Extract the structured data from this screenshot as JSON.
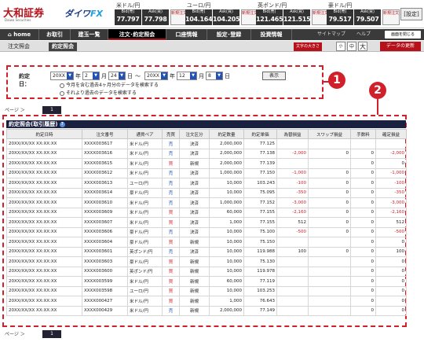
{
  "header": {
    "logo": "大和証券",
    "logo_sub": "Daiwa Securities",
    "fx_logo_a": "ダイワ",
    "fx_logo_b": "FX",
    "settings_label": "[設定]",
    "rates": [
      {
        "pair": "米ドル/円",
        "bid_label": "Bid(売)",
        "ask_label": "Ask(買)",
        "bid": "77.797",
        "ask": "77.798",
        "new_label": "新規注文"
      },
      {
        "pair": "ユーロ/円",
        "bid_label": "Bid(売)",
        "ask_label": "Ask(買)",
        "bid": "104.164",
        "ask": "104.205",
        "new_label": "新規注文"
      },
      {
        "pair": "英ポンド/円",
        "bid_label": "Bid(売)",
        "ask_label": "Ask(買)",
        "bid": "121.465",
        "ask": "121.515",
        "new_label": "新規注文"
      },
      {
        "pair": "豪ドル/円",
        "bid_label": "Bid(売)",
        "ask_label": "Ask(買)",
        "bid": "79.517",
        "ask": "79.507",
        "new_label": "新規注文"
      }
    ]
  },
  "nav": {
    "items": [
      "⌂ home",
      "お取引",
      "建玉一覧",
      "注文･約定照会",
      "口座情報",
      "設定･登録",
      "投資情報"
    ],
    "sitemap": "サイトマップ",
    "help": "ヘルプ",
    "close_label": "画面を閉じる"
  },
  "subnav": {
    "items": [
      "注文照会",
      "約定照会"
    ],
    "font_size_label": "文字の大きさ",
    "font_sizes": [
      "小",
      "中",
      "大"
    ],
    "update_label": "データの更新"
  },
  "search": {
    "label": "約定日：",
    "from_year": "20XX",
    "from_month": "2",
    "from_day": "24",
    "to_year": "20XX",
    "to_month": "12",
    "to_day": "8",
    "year_unit": "年",
    "month_unit": "月",
    "day_unit": "日",
    "range_sep": "～",
    "show_button": "表示",
    "radio1": "今月を含む過去4ヶ月分のデータを検索する",
    "radio2": "それより過去のデータを検索する"
  },
  "annotations": {
    "badge1": "1",
    "badge2": "2"
  },
  "pager": {
    "label": "ページ ＞",
    "page": "1"
  },
  "results": {
    "title": "約定照会(取引履歴)",
    "help_icon": "?",
    "columns": [
      "約定日時",
      "注文番号",
      "通貨ペア",
      "売買",
      "注文区分",
      "約定数量",
      "約定単価",
      "為替損益",
      "スワップ損益",
      "手数料",
      "確定損益"
    ],
    "rows": [
      [
        "20XX/XX/XX XX:XX:XX",
        "XXXX003617",
        "米ドル/円",
        "売",
        "決済",
        "2,000,000",
        "77.125",
        "",
        "",
        "",
        ""
      ],
      [
        "20XX/XX/XX XX:XX:XX",
        "XXXX003616",
        "米ドル/円",
        "売",
        "決済",
        "2,000,000",
        "77.138",
        "-2,000",
        "0",
        "0",
        "-2,000"
      ],
      [
        "20XX/XX/XX XX:XX:XX",
        "XXXX003615",
        "米ドル/円",
        "買",
        "新規",
        "2,000,000",
        "77.139",
        "",
        "",
        "0",
        "0"
      ],
      [
        "20XX/XX/XX XX:XX:XX",
        "XXXX003612",
        "米ドル/円",
        "売",
        "決済",
        "1,000,000",
        "77.150",
        "-1,000",
        "0",
        "0",
        "-1,000"
      ],
      [
        "20XX/XX/XX XX:XX:XX",
        "XXXX003613",
        "ユーロ/円",
        "売",
        "決済",
        "10,000",
        "103.243",
        "-100",
        "0",
        "0",
        "-100"
      ],
      [
        "20XX/XX/XX XX:XX:XX",
        "XXXX003614",
        "豪ドル/円",
        "売",
        "決済",
        "10,000",
        "75.095",
        "-350",
        "0",
        "0",
        "-350"
      ],
      [
        "20XX/XX/XX XX:XX:XX",
        "XXXX003610",
        "米ドル/円",
        "売",
        "決済",
        "1,000,000",
        "77.152",
        "-3,000",
        "0",
        "0",
        "-3,000"
      ],
      [
        "20XX/XX/XX XX:XX:XX",
        "XXXX003609",
        "米ドル/円",
        "買",
        "決済",
        "60,000",
        "77.155",
        "-2,160",
        "0",
        "0",
        "-2,160"
      ],
      [
        "20XX/XX/XX XX:XX:XX",
        "XXXX003607",
        "米ドル/円",
        "買",
        "決済",
        "1,000",
        "77.155",
        "512",
        "0",
        "0",
        "512"
      ],
      [
        "20XX/XX/XX XX:XX:XX",
        "XXXX003606",
        "豪ドル/円",
        "売",
        "決済",
        "10,000",
        "75.100",
        "-500",
        "0",
        "0",
        "-500"
      ],
      [
        "20XX/XX/XX XX:XX:XX",
        "XXXX003604",
        "豪ドル/円",
        "買",
        "新規",
        "10,000",
        "75.150",
        "",
        "",
        "0",
        "0"
      ],
      [
        "20XX/XX/XX XX:XX:XX",
        "XXXX003601",
        "英ポンド/円",
        "売",
        "決済",
        "10,000",
        "119.988",
        "100",
        "0",
        "0",
        "100"
      ],
      [
        "20XX/XX/XX XX:XX:XX",
        "XXXX003603",
        "豪ドル/円",
        "買",
        "新規",
        "10,000",
        "75.130",
        "",
        "",
        "0",
        "0"
      ],
      [
        "20XX/XX/XX XX:XX:XX",
        "XXXX003600",
        "英ポンド/円",
        "買",
        "新規",
        "10,000",
        "119.978",
        "",
        "",
        "0",
        "0"
      ],
      [
        "20XX/XX/XX XX:XX:XX",
        "XXXX003599",
        "米ドル/円",
        "買",
        "新規",
        "60,000",
        "77.119",
        "",
        "",
        "0",
        "0"
      ],
      [
        "20XX/XX/XX XX:XX:XX",
        "XXXX003598",
        "ユーロ/円",
        "買",
        "新規",
        "10,000",
        "103.253",
        "",
        "",
        "0",
        "0"
      ],
      [
        "20XX/XX/XX XX:XX:XX",
        "XXXX000427",
        "米ドル/円",
        "買",
        "新規",
        "1,000",
        "76.643",
        "",
        "",
        "0",
        "0"
      ],
      [
        "20XX/XX/XX XX:XX:XX",
        "XXXX000429",
        "米ドル/円",
        "売",
        "新規",
        "2,000,000",
        "77.149",
        "",
        "",
        "0",
        "0"
      ]
    ]
  },
  "colors": {
    "brand": "#b5121b",
    "buy": "#d0202a",
    "sell": "#2250b5",
    "annotation": "#d0202a"
  }
}
